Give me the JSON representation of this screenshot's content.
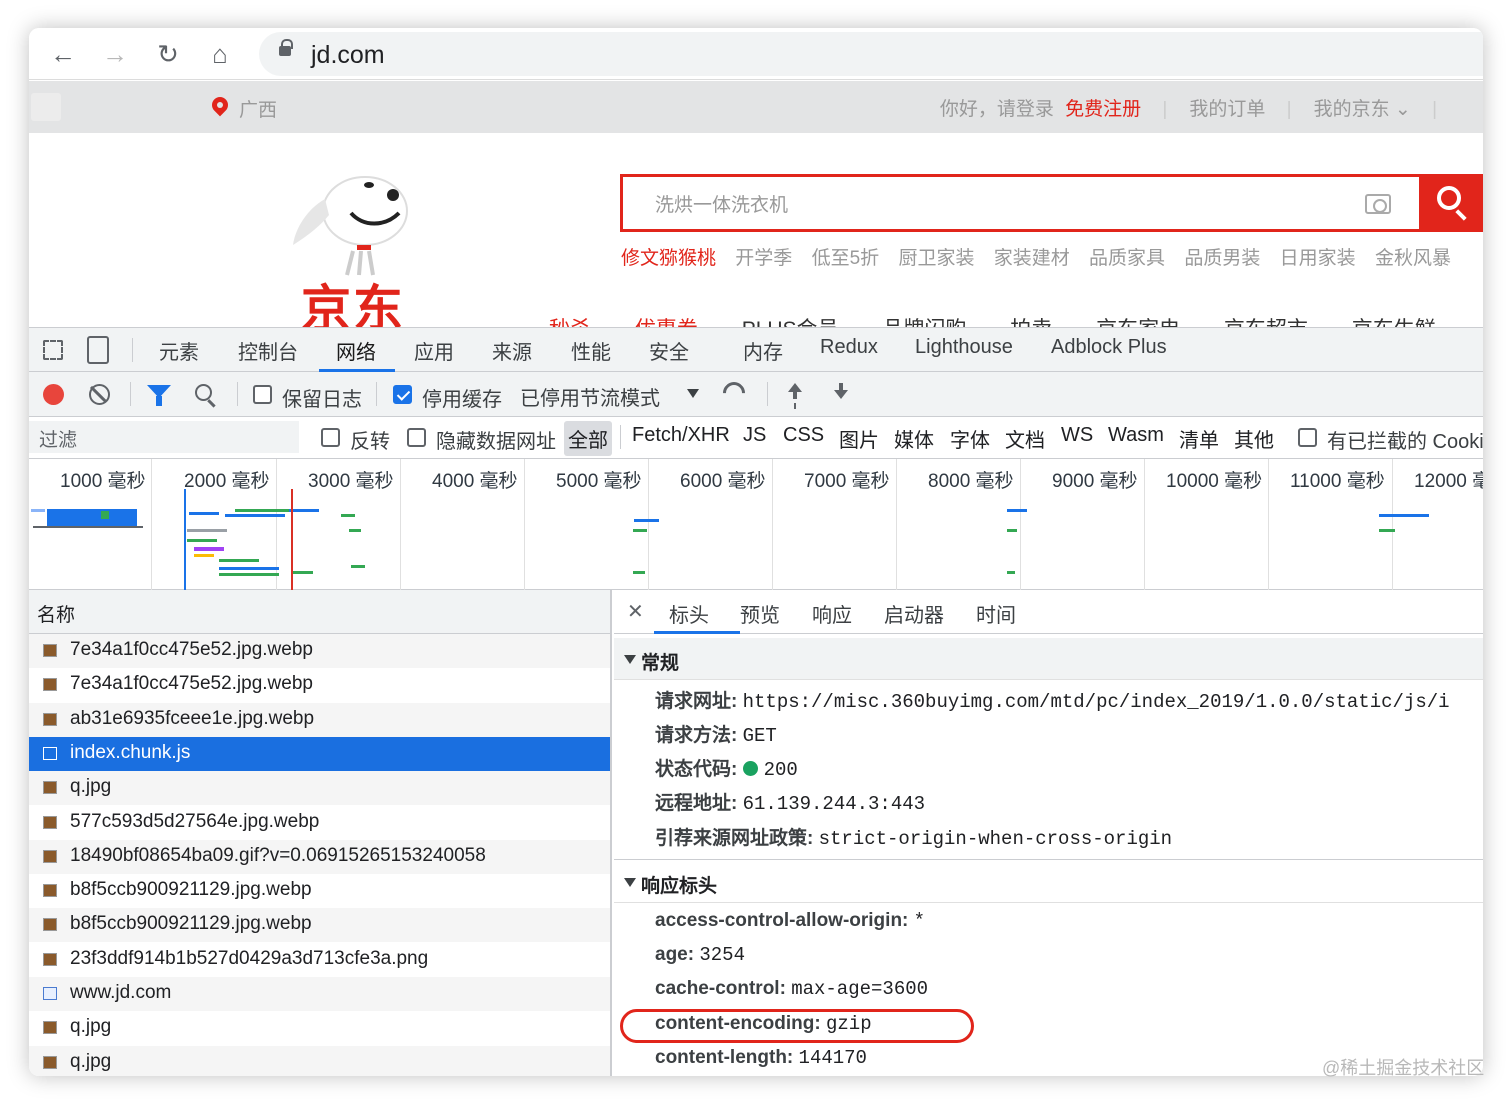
{
  "browser": {
    "url": "jd.com"
  },
  "jd_page": {
    "location": "广西",
    "greeting": "你好，请登录",
    "register": "免费注册",
    "my_orders": "我的订单",
    "my_jd": "我的京东 ⌄",
    "logo_text": "京东",
    "search_placeholder": "洗烘一体洗衣机",
    "hotwords": [
      "修文猕猴桃",
      "开学季",
      "低至5折",
      "厨卫家装",
      "家装建材",
      "品质家具",
      "品质男装",
      "日用家装",
      "金秋风暴"
    ],
    "nav_items": [
      "秒杀",
      "优惠券",
      "PLUS会员",
      "品牌闪购",
      "拍卖",
      "京东家电",
      "京东超市",
      "京东生鲜"
    ],
    "brand_color": "#e1251b"
  },
  "devtools": {
    "tabs": [
      "元素",
      "控制台",
      "网络",
      "应用",
      "来源",
      "性能",
      "安全",
      "内存",
      "Redux",
      "Lighthouse",
      "Adblock Plus"
    ],
    "active_tab": "网络",
    "toolbar": {
      "preserve_log": "保留日志",
      "disable_cache": "停用缓存",
      "throttling": "已停用节流模式"
    },
    "filter": {
      "placeholder": "过滤",
      "invert": "反转",
      "hide_data_urls": "隐藏数据网址",
      "types": [
        "全部",
        "Fetch/XHR",
        "JS",
        "CSS",
        "图片",
        "媒体",
        "字体",
        "文档",
        "WS",
        "Wasm",
        "清单",
        "其他"
      ],
      "blocked_cookies": "有已拦截的 Cooki"
    },
    "timeline_labels": [
      "1000 毫秒",
      "2000 毫秒",
      "3000 毫秒",
      "4000 毫秒",
      "5000 毫秒",
      "6000 毫秒",
      "7000 毫秒",
      "8000 毫秒",
      "9000 毫秒",
      "10000 毫秒",
      "11000 毫秒",
      "12000 毫"
    ],
    "name_header": "名称",
    "requests": [
      {
        "name": "7e34a1f0cc475e52.jpg.webp",
        "icon": "image-icon"
      },
      {
        "name": "7e34a1f0cc475e52.jpg.webp",
        "icon": "image-icon"
      },
      {
        "name": "ab31e6935fceee1e.jpg.webp",
        "icon": "image-icon"
      },
      {
        "name": "index.chunk.js",
        "icon": "script-icon"
      },
      {
        "name": "q.jpg",
        "icon": "image-icon"
      },
      {
        "name": "577c593d5d27564e.jpg.webp",
        "icon": "image-icon"
      },
      {
        "name": "18490bf08654ba09.gif?v=0.06915265153240058",
        "icon": "image-icon"
      },
      {
        "name": "b8f5ccb900921129.jpg.webp",
        "icon": "image-icon"
      },
      {
        "name": "b8f5ccb900921129.jpg.webp",
        "icon": "image-icon"
      },
      {
        "name": "23f3ddf914b1b527d0429a3d713cfe3a.png",
        "icon": "image-icon"
      },
      {
        "name": "www.jd.com",
        "icon": "document-icon"
      },
      {
        "name": "q.jpg",
        "icon": "image-icon"
      },
      {
        "name": "q.jpg",
        "icon": "image-icon"
      }
    ],
    "selected_request": "index.chunk.js",
    "detail_tabs": [
      "标头",
      "预览",
      "响应",
      "启动器",
      "时间"
    ],
    "general_title": "常规",
    "general": [
      {
        "key": "请求网址:",
        "value": "https://misc.360buyimg.com/mtd/pc/index_2019/1.0.0/static/js/i"
      },
      {
        "key": "请求方法:",
        "value": "GET"
      },
      {
        "key": "状态代码:",
        "value": "200"
      },
      {
        "key": "远程地址:",
        "value": "61.139.244.3:443"
      },
      {
        "key": "引荐来源网址政策:",
        "value": "strict-origin-when-cross-origin"
      }
    ],
    "response_headers_title": "响应标头",
    "response_headers": [
      {
        "key": "access-control-allow-origin:",
        "value": "*"
      },
      {
        "key": "age:",
        "value": "3254"
      },
      {
        "key": "cache-control:",
        "value": "max-age=3600"
      },
      {
        "key": "content-encoding:",
        "value": "gzip"
      },
      {
        "key": "content-length:",
        "value": "144170"
      }
    ],
    "highlighted_header": "content-encoding:"
  },
  "watermark": "@稀土掘金技术社区"
}
